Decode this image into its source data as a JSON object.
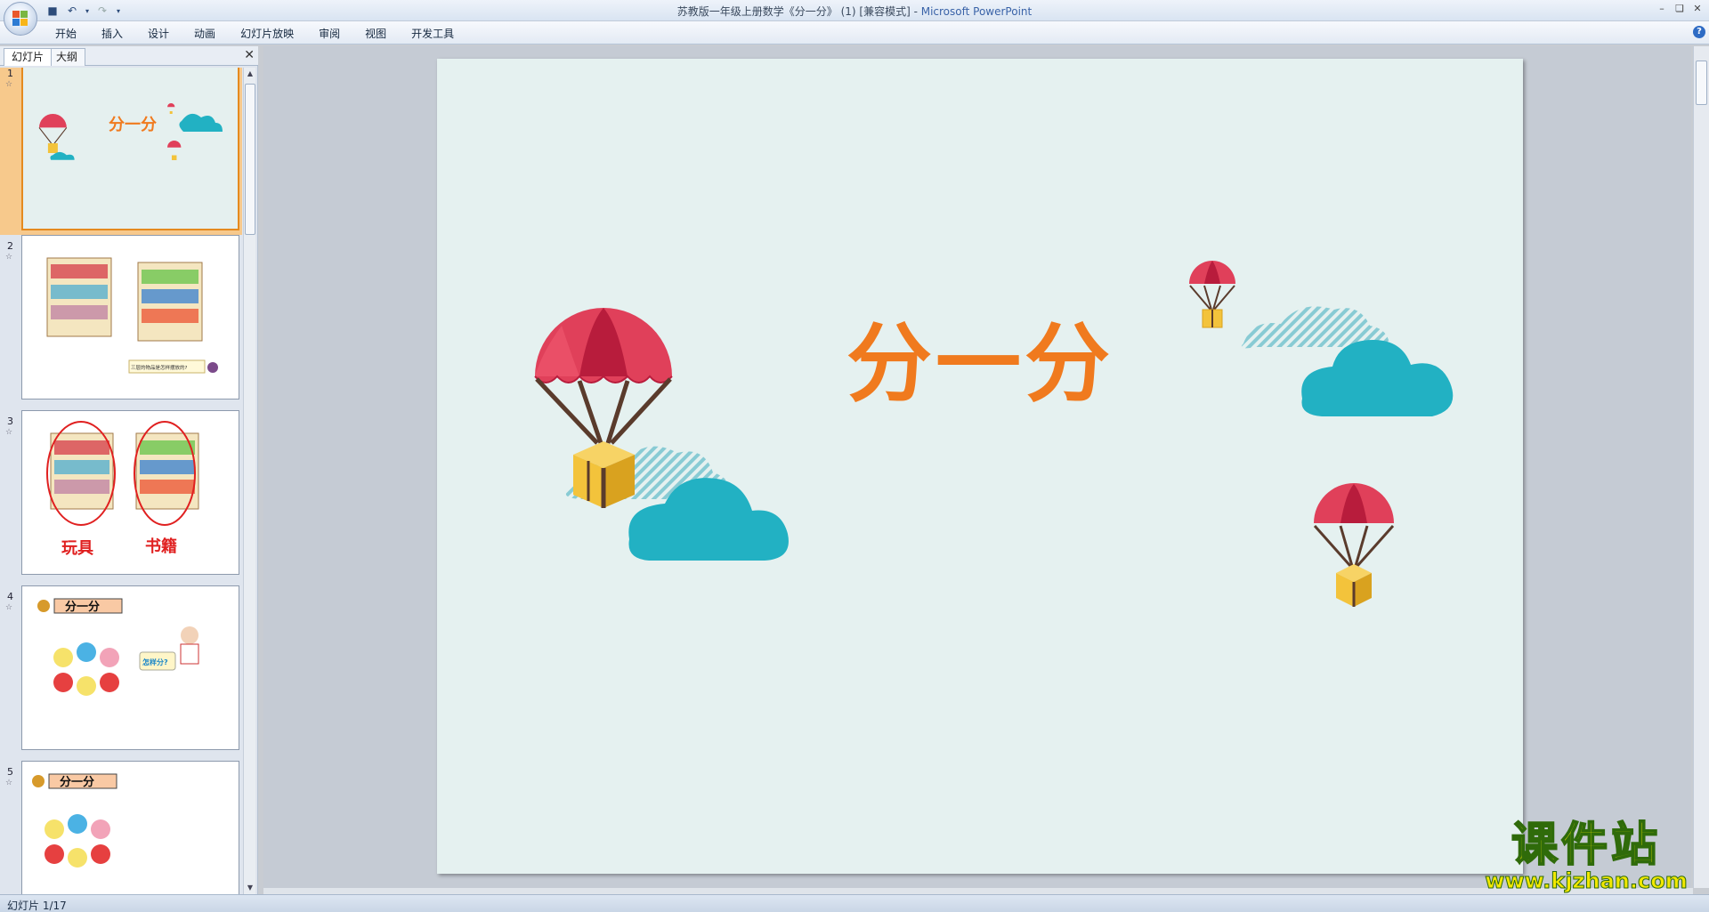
{
  "window": {
    "title": "苏教版一年级上册数学《分一分》 (1) [兼容模式] - ",
    "app_name": "Microsoft PowerPoint"
  },
  "ribbon": {
    "tabs": [
      "开始",
      "插入",
      "设计",
      "动画",
      "幻灯片放映",
      "审阅",
      "视图",
      "开发工具"
    ]
  },
  "left_pane": {
    "tabs": [
      "幻灯片",
      "大纲"
    ],
    "slides": [
      {
        "number": "1",
        "title": "分一分"
      },
      {
        "number": "2",
        "caption": "三层的物品是怎样摆放的?"
      },
      {
        "number": "3",
        "label_left": "玩具",
        "label_right": "书籍"
      },
      {
        "number": "4",
        "header": "分一分",
        "bubble": "怎样分?"
      },
      {
        "number": "5",
        "header": "分一分"
      }
    ]
  },
  "slide": {
    "title": "分一分"
  },
  "status": {
    "slide_indicator": "幻灯片 1/17"
  },
  "watermark": {
    "main": "课件站",
    "url": "www.kjzhan.com"
  },
  "colors": {
    "slide_bg": "#e5f1f0",
    "title_orange": "#f07a1e",
    "parachute_red": "#e0405a",
    "cloud_teal": "#22b1c3",
    "box_gold": "#f3c33b"
  }
}
